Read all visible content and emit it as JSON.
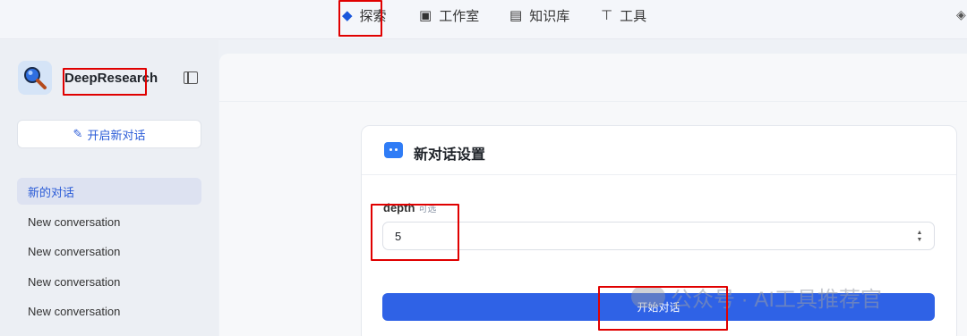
{
  "topnav": {
    "items": [
      {
        "label": "探索",
        "icon": "compass-leaf-icon"
      },
      {
        "label": "工作室",
        "icon": "robot-icon"
      },
      {
        "label": "知识库",
        "icon": "book-icon"
      },
      {
        "label": "工具",
        "icon": "hammer-icon"
      }
    ],
    "accent": "#1a56db"
  },
  "sidebar": {
    "app_name": "DeepResearch",
    "new_chat_label": "开启新对话",
    "conversations": [
      {
        "label": "新的对话",
        "active": true
      },
      {
        "label": "New conversation",
        "active": false
      },
      {
        "label": "New conversation",
        "active": false
      },
      {
        "label": "New conversation",
        "active": false
      },
      {
        "label": "New conversation",
        "active": false
      }
    ]
  },
  "settings_card": {
    "title": "新对话设置",
    "field_label": "depth",
    "field_optional": "可选",
    "depth_value": "5",
    "start_label": "开始对话",
    "button_color": "#2f62e6"
  },
  "watermark": {
    "text": "公众号 · AI工具推荐官"
  },
  "highlight_color": "#e00000"
}
